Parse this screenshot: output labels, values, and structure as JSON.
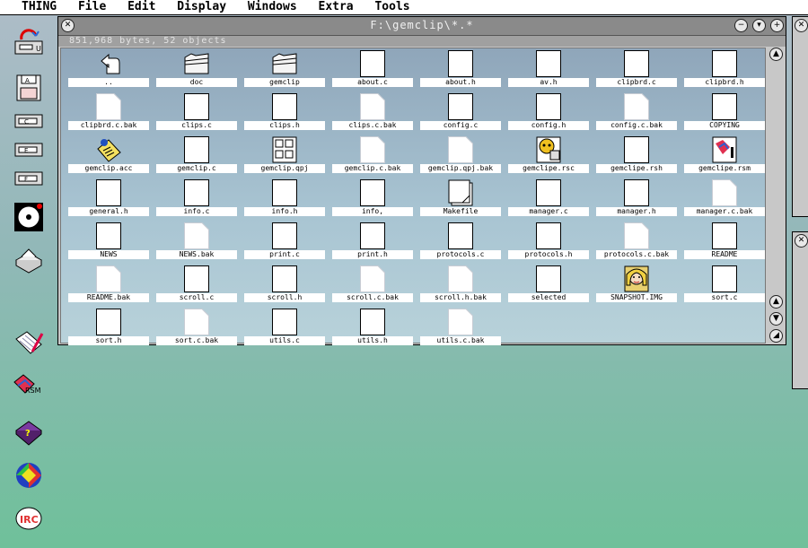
{
  "menu": [
    "THING",
    "File",
    "Edit",
    "Display",
    "Windows",
    "Extra",
    "Tools"
  ],
  "window": {
    "title": "F:\\gemclip\\*.*",
    "info": "851,968 bytes, 52 objects"
  },
  "files": [
    {
      "name": "..",
      "icon": "parent"
    },
    {
      "name": "doc",
      "icon": "folder"
    },
    {
      "name": "gemclip",
      "icon": "folder"
    },
    {
      "name": "about.c",
      "icon": "file"
    },
    {
      "name": "about.h",
      "icon": "file"
    },
    {
      "name": "av.h",
      "icon": "file"
    },
    {
      "name": "clipbrd.c",
      "icon": "file"
    },
    {
      "name": "clipbrd.h",
      "icon": "file"
    },
    {
      "name": "clipbrd.c.bak",
      "icon": "file-light"
    },
    {
      "name": "clips.c",
      "icon": "file"
    },
    {
      "name": "clips.h",
      "icon": "file"
    },
    {
      "name": "clips.c.bak",
      "icon": "file-light"
    },
    {
      "name": "config.c",
      "icon": "file"
    },
    {
      "name": "config.h",
      "icon": "file"
    },
    {
      "name": "config.c.bak",
      "icon": "file-light"
    },
    {
      "name": "COPYING",
      "icon": "file"
    },
    {
      "name": "gemclip.acc",
      "icon": "note"
    },
    {
      "name": "gemclip.c",
      "icon": "file"
    },
    {
      "name": "gemclip.qpj",
      "icon": "project"
    },
    {
      "name": "gemclip.c.bak",
      "icon": "file-light"
    },
    {
      "name": "gemclip.qpj.bak",
      "icon": "file-light"
    },
    {
      "name": "gemclipe.rsc",
      "icon": "resource"
    },
    {
      "name": "gemclipe.rsh",
      "icon": "file"
    },
    {
      "name": "gemclipe.rsm",
      "icon": "rsm"
    },
    {
      "name": "general.h",
      "icon": "file"
    },
    {
      "name": "info.c",
      "icon": "file"
    },
    {
      "name": "info.h",
      "icon": "file"
    },
    {
      "name": "info,",
      "icon": "file"
    },
    {
      "name": "Makefile",
      "icon": "makefile"
    },
    {
      "name": "manager.c",
      "icon": "file"
    },
    {
      "name": "manager.h",
      "icon": "file"
    },
    {
      "name": "manager.c.bak",
      "icon": "file-light"
    },
    {
      "name": "NEWS",
      "icon": "file"
    },
    {
      "name": "NEWS.bak",
      "icon": "file-light"
    },
    {
      "name": "print.c",
      "icon": "file"
    },
    {
      "name": "print.h",
      "icon": "file"
    },
    {
      "name": "protocols.c",
      "icon": "file"
    },
    {
      "name": "protocols.h",
      "icon": "file"
    },
    {
      "name": "protocols.c.bak",
      "icon": "file-light"
    },
    {
      "name": "README",
      "icon": "file"
    },
    {
      "name": "README.bak",
      "icon": "file-light"
    },
    {
      "name": "scroll.c",
      "icon": "file"
    },
    {
      "name": "scroll.h",
      "icon": "file"
    },
    {
      "name": "scroll.c.bak",
      "icon": "file-light"
    },
    {
      "name": "scroll.h.bak",
      "icon": "file-light"
    },
    {
      "name": "selected",
      "icon": "file"
    },
    {
      "name": "SNAPSHOT.IMG",
      "icon": "image"
    },
    {
      "name": "sort.c",
      "icon": "file"
    },
    {
      "name": "sort.h",
      "icon": "file"
    },
    {
      "name": "sort.c.bak",
      "icon": "file-light"
    },
    {
      "name": "utils.c",
      "icon": "file"
    },
    {
      "name": "utils.h",
      "icon": "file"
    },
    {
      "name": "utils.c.bak",
      "icon": "file-light"
    }
  ],
  "desktop": {
    "drives": [
      {
        "icon": "floppy-drive-icon",
        "letter": "U"
      },
      {
        "icon": "floppy-disk-icon",
        "letter": "A"
      },
      {
        "icon": "hard-drive-icon",
        "letter": "C"
      },
      {
        "icon": "hard-drive-icon",
        "letter": "E"
      },
      {
        "icon": "hard-drive-icon",
        "letter": "F"
      }
    ],
    "apps": [
      {
        "icon": "cd-rom-icon"
      },
      {
        "icon": "printer-icon"
      },
      {
        "icon": "notepad-pen-icon"
      },
      {
        "icon": "rsm-icon",
        "label": "RSM"
      },
      {
        "icon": "help-book-icon"
      },
      {
        "icon": "colorful-app-icon"
      },
      {
        "icon": "irc-client-icon",
        "label": "IRC"
      }
    ]
  },
  "colors": {
    "menu_bg": "#ffffff",
    "title_bg": "#8a8a8a",
    "window_frame": "#c8c8c8",
    "label_bg": "#ffffff"
  }
}
